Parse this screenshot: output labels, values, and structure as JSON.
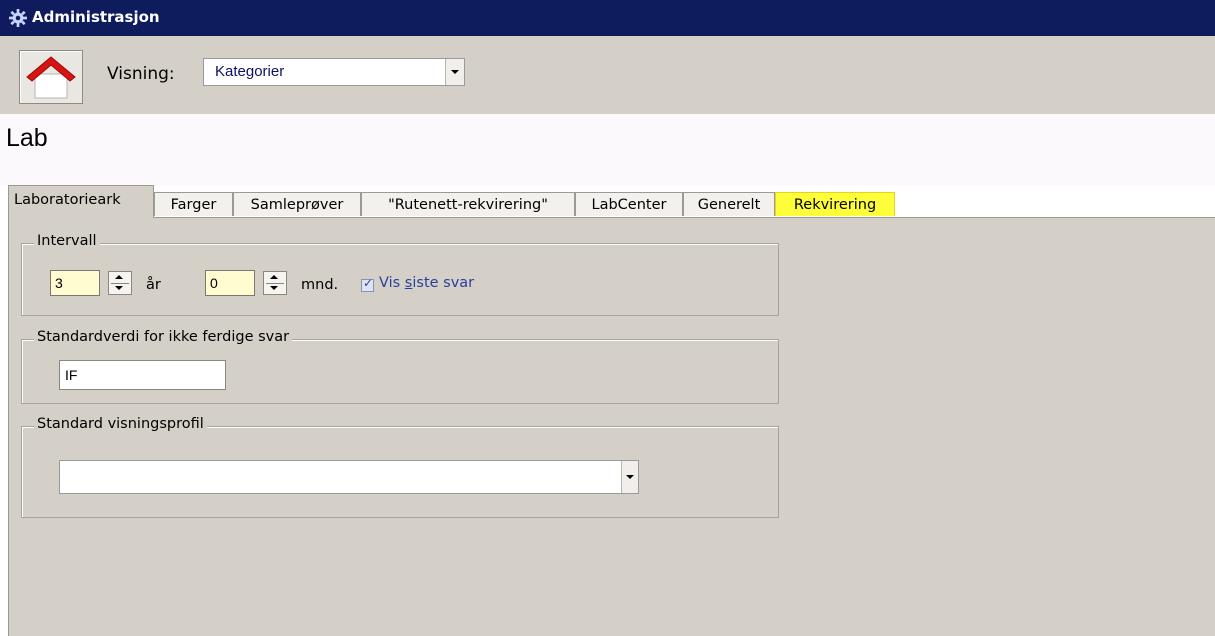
{
  "window": {
    "title": "Administrasjon",
    "icon": "gear-icon"
  },
  "toolbar": {
    "home_icon": "home-icon",
    "visning_label": "Visning:",
    "visning_value": "Kategorier"
  },
  "page": {
    "heading": "Lab"
  },
  "tabs": [
    {
      "label": "Laboratorieark",
      "active": true
    },
    {
      "label": "Farger"
    },
    {
      "label": "Samleprøver"
    },
    {
      "label": "\"Rutenett-rekvirering\""
    },
    {
      "label": "LabCenter"
    },
    {
      "label": "Generelt"
    },
    {
      "label": "Rekvirering",
      "highlighted": true
    }
  ],
  "intervall": {
    "legend": "Intervall",
    "years_value": "3",
    "years_unit": "år",
    "months_value": "0",
    "months_unit": "mnd.",
    "checkbox_label_prefix": "Vis ",
    "checkbox_label_underlined": "s",
    "checkbox_label_suffix": "iste svar",
    "checkbox_checked": true
  },
  "standardverdi": {
    "legend": "Standardverdi for ikke ferdige svar",
    "value": "IF"
  },
  "visningsprofil": {
    "legend": "Standard visningsprofil",
    "value": ""
  },
  "colors": {
    "titlebar": "#0e1c5e",
    "panel": "#d4d0c8",
    "highlight": "#fdfd3a",
    "checkbox_text": "#2a3f9a"
  }
}
